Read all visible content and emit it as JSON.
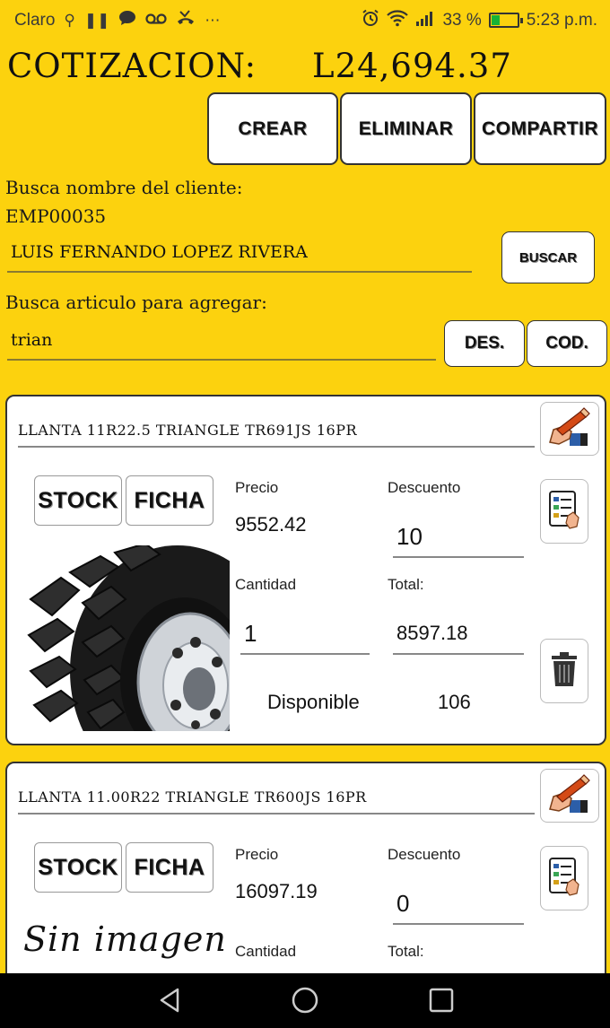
{
  "status_bar": {
    "carrier": "Claro",
    "left_icons": [
      "usb-icon",
      "pause-icon",
      "chat-icon",
      "voicemail-icon",
      "missed-call-icon",
      "more-icon"
    ],
    "battery_percent": "33 %",
    "battery_level": 0.33,
    "time": "5:23 p.m."
  },
  "header": {
    "title": "COTIZACION:",
    "total": "L24,694.37"
  },
  "actions": {
    "crear": "CREAR",
    "eliminar": "ELIMINAR",
    "compartir": "COMPARTIR"
  },
  "client": {
    "label": "Busca nombre del cliente:",
    "code": "EMP00035",
    "name": "LUIS FERNANDO LOPEZ RIVERA",
    "search_button": "BUSCAR"
  },
  "article": {
    "label": "Busca articulo para agregar:",
    "query": "trian",
    "des_button": "DES.",
    "cod_button": "COD."
  },
  "items": [
    {
      "title": "LLANTA  11R22.5 TRIANGLE TR691JS 16PR",
      "stock_label": "STOCK",
      "ficha_label": "FICHA",
      "precio_label": "Precio",
      "precio": "9552.42",
      "descuento_label": "Descuento",
      "descuento": "10",
      "cantidad_label": "Cantidad",
      "cantidad": "1",
      "total_label": "Total:",
      "total": "8597.18",
      "disponible_label": "Disponible",
      "disponible": "106",
      "image": "tire-image"
    },
    {
      "title": "LLANTA  11.00R22 TRIANGLE TR600JS 16PR",
      "stock_label": "STOCK",
      "ficha_label": "FICHA",
      "precio_label": "Precio",
      "precio": "16097.19",
      "descuento_label": "Descuento",
      "descuento": "0",
      "cantidad_label": "Cantidad",
      "total_label": "Total:",
      "no_image_text": "Sin imagen"
    }
  ],
  "nav": {
    "back": "back-icon",
    "home": "home-icon",
    "recents": "recents-icon"
  },
  "colors": {
    "background": "#fcd20e",
    "card": "#ffffff",
    "battery_fill": "#16b336"
  }
}
